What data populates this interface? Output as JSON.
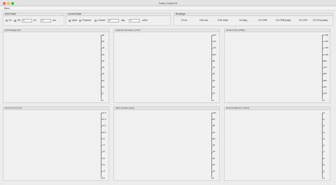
{
  "window": {
    "title": "Fusion Control UI"
  },
  "menu": {
    "label": "Menu"
  },
  "grid_power": {
    "title": "Grid Power",
    "on_label": "On",
    "off_label": "Off",
    "selected": "off",
    "voltage_value": "0",
    "voltage_unit": "kV",
    "current_value": "0",
    "current_unit": "mA"
  },
  "control_mode": {
    "title": "Control Mode",
    "valve_label": "Valve",
    "pressure_label": "Pressure",
    "current_label": "Current",
    "selected": "valve",
    "valve_value": "0",
    "valve_unit": "deg",
    "pressure_value": "0",
    "pressure_unit": "mTorr"
  },
  "readings": {
    "title": "Readings",
    "values": [
      "0.0 kv",
      "0.00 mA",
      "0.00 mTorr",
      "0.0 deg",
      "0.0 CPM",
      "0.0 CPM (max)",
      "0.0 CF/s",
      "0.0 CF/s (max)"
    ]
  },
  "panels": [
    {
      "title": "Grid Voltage (kV)",
      "ticks": [
        "50",
        "45",
        "40",
        "35",
        "30",
        "25",
        "20",
        "15",
        "10",
        "5",
        "0"
      ]
    },
    {
      "title": "Chamber Pressure (mTorr)",
      "ticks": [
        "150",
        "135",
        "120",
        "105",
        "90",
        "75",
        "60",
        "45",
        "30",
        "15",
        "0"
      ]
    },
    {
      "title": "Neutron Flux (CPM)",
      "ticks": [
        "1,500",
        "1,350",
        "1,200",
        "1,050",
        "900",
        "750",
        "600",
        "450",
        "300",
        "150",
        "0"
      ]
    },
    {
      "title": "Grid Current (mA)",
      "ticks": [
        "15.0",
        "13.5",
        "12.0",
        "10.5",
        "9.0",
        "7.5",
        "6.0",
        "4.5",
        "3.0",
        "1.5",
        "0.0"
      ]
    },
    {
      "title": "Valve Position (deg)",
      "ticks": [
        "100",
        "90",
        "80",
        "70",
        "60",
        "50",
        "40",
        "30",
        "20",
        "10",
        "0"
      ]
    },
    {
      "title": "Reactor Efficiency (CF/s)",
      "ticks": [
        "0",
        "0",
        "0",
        "0",
        "0",
        "0",
        "0",
        "0",
        "0",
        "0",
        "0"
      ]
    }
  ],
  "colors": {
    "accent": "#1f6feb",
    "window_bg": "#ececec",
    "panel_header": "#e6e6e6"
  }
}
